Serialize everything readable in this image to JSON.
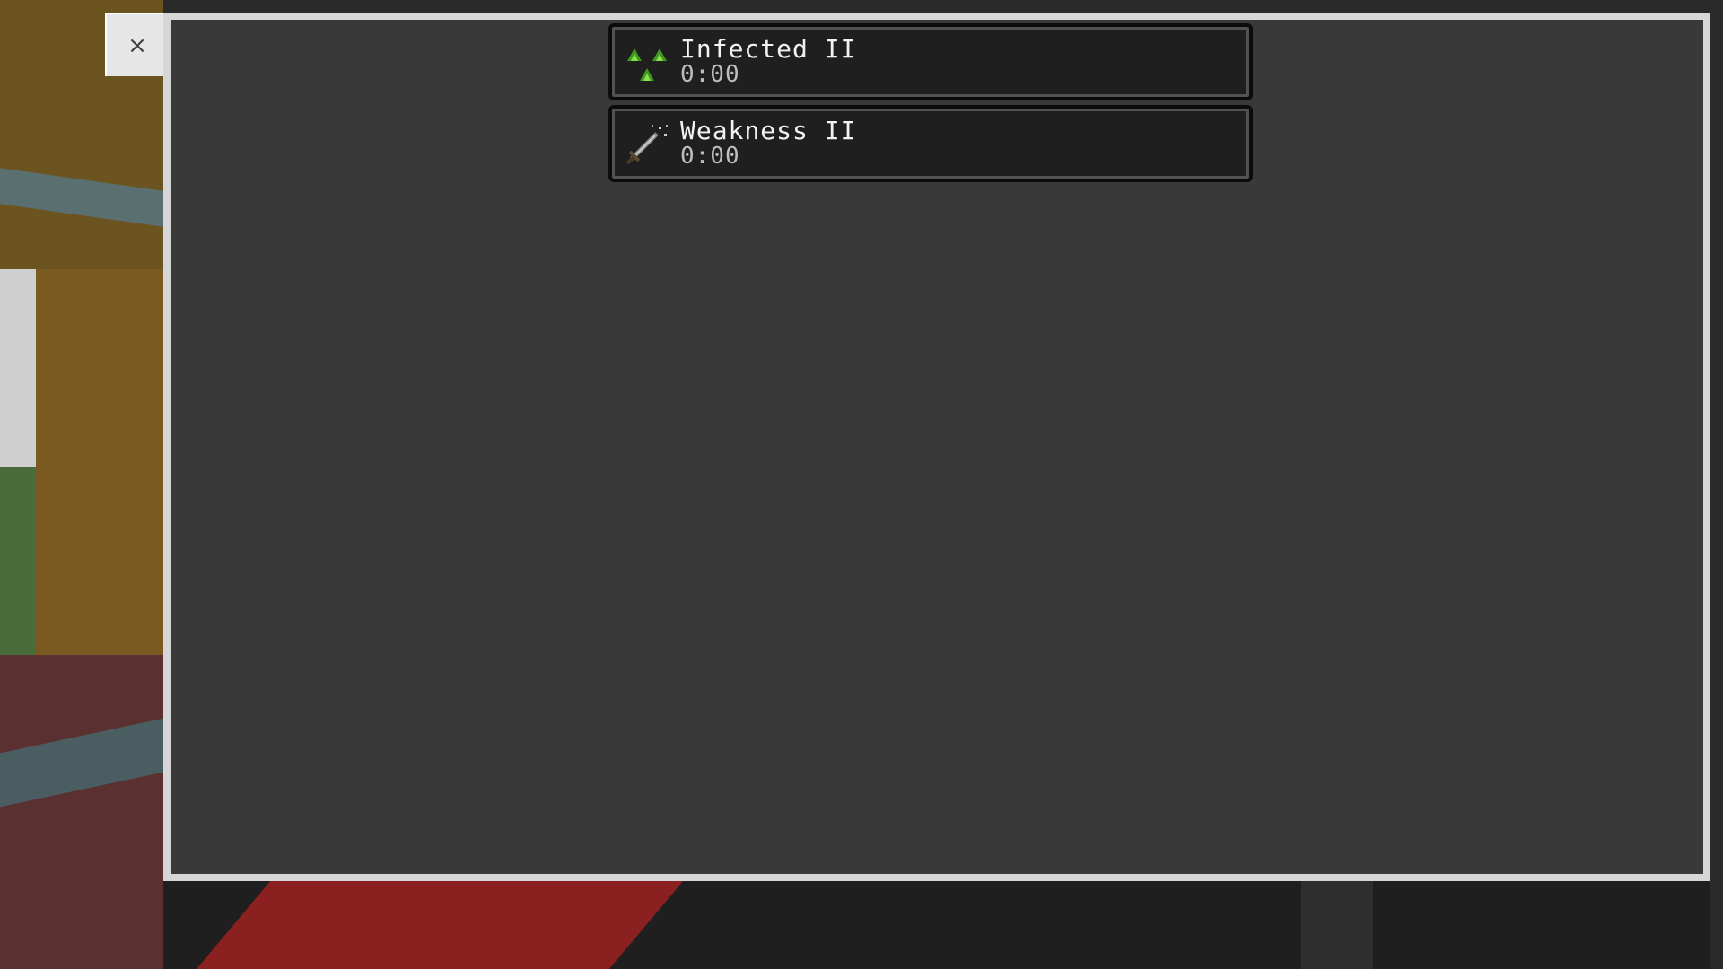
{
  "dialog": {
    "close_label": "×"
  },
  "effects": [
    {
      "name": "Infected II",
      "time": "0:00",
      "icon": "infected-spores-icon"
    },
    {
      "name": "Weakness II",
      "time": "0:00",
      "icon": "weakness-sword-icon"
    }
  ],
  "colors": {
    "panel_border": "#d6d6d6",
    "panel_fill": "#393939",
    "effect_bg": "#1f1f1f",
    "infected_green": "#4caf28"
  }
}
